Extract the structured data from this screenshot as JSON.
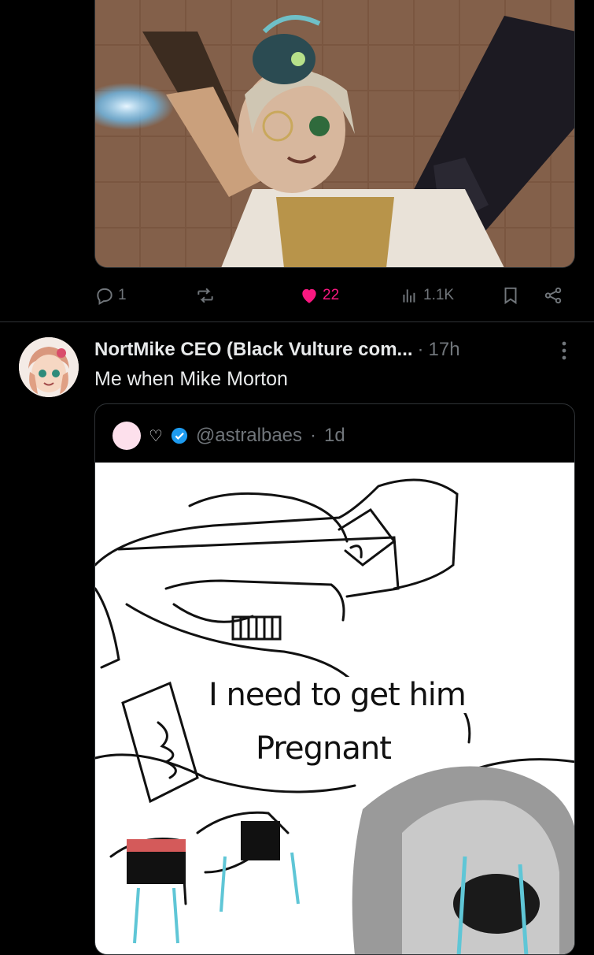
{
  "previous_post": {
    "media_alt": "",
    "actions": {
      "reply_count": "1",
      "repost_count": "",
      "like_count": "22",
      "view_count": "1.1K"
    }
  },
  "post": {
    "author_name": "NortMike CEO (Black Vulture com...",
    "separator": "·",
    "time": "17h",
    "text": "Me when Mike Morton",
    "quoted": {
      "name_heart": "♡",
      "handle": "@astralbaes",
      "separator": "·",
      "time": "1d",
      "image_caption_line1": "I need to get him",
      "image_caption_line2": "Pregnant"
    }
  },
  "colors": {
    "background": "#000000",
    "text_primary": "#e7e9ea",
    "text_secondary": "#71767b",
    "like_active": "#f91880",
    "verified_badge": "#1d9bf0",
    "divider": "#2f3336"
  },
  "icons": {
    "reply": "reply-icon",
    "repost": "repost-icon",
    "like": "heart-filled-icon",
    "views": "analytics-icon",
    "bookmark": "bookmark-icon",
    "share": "share-icon",
    "more": "more-vertical-icon",
    "verified": "verified-badge-icon"
  }
}
